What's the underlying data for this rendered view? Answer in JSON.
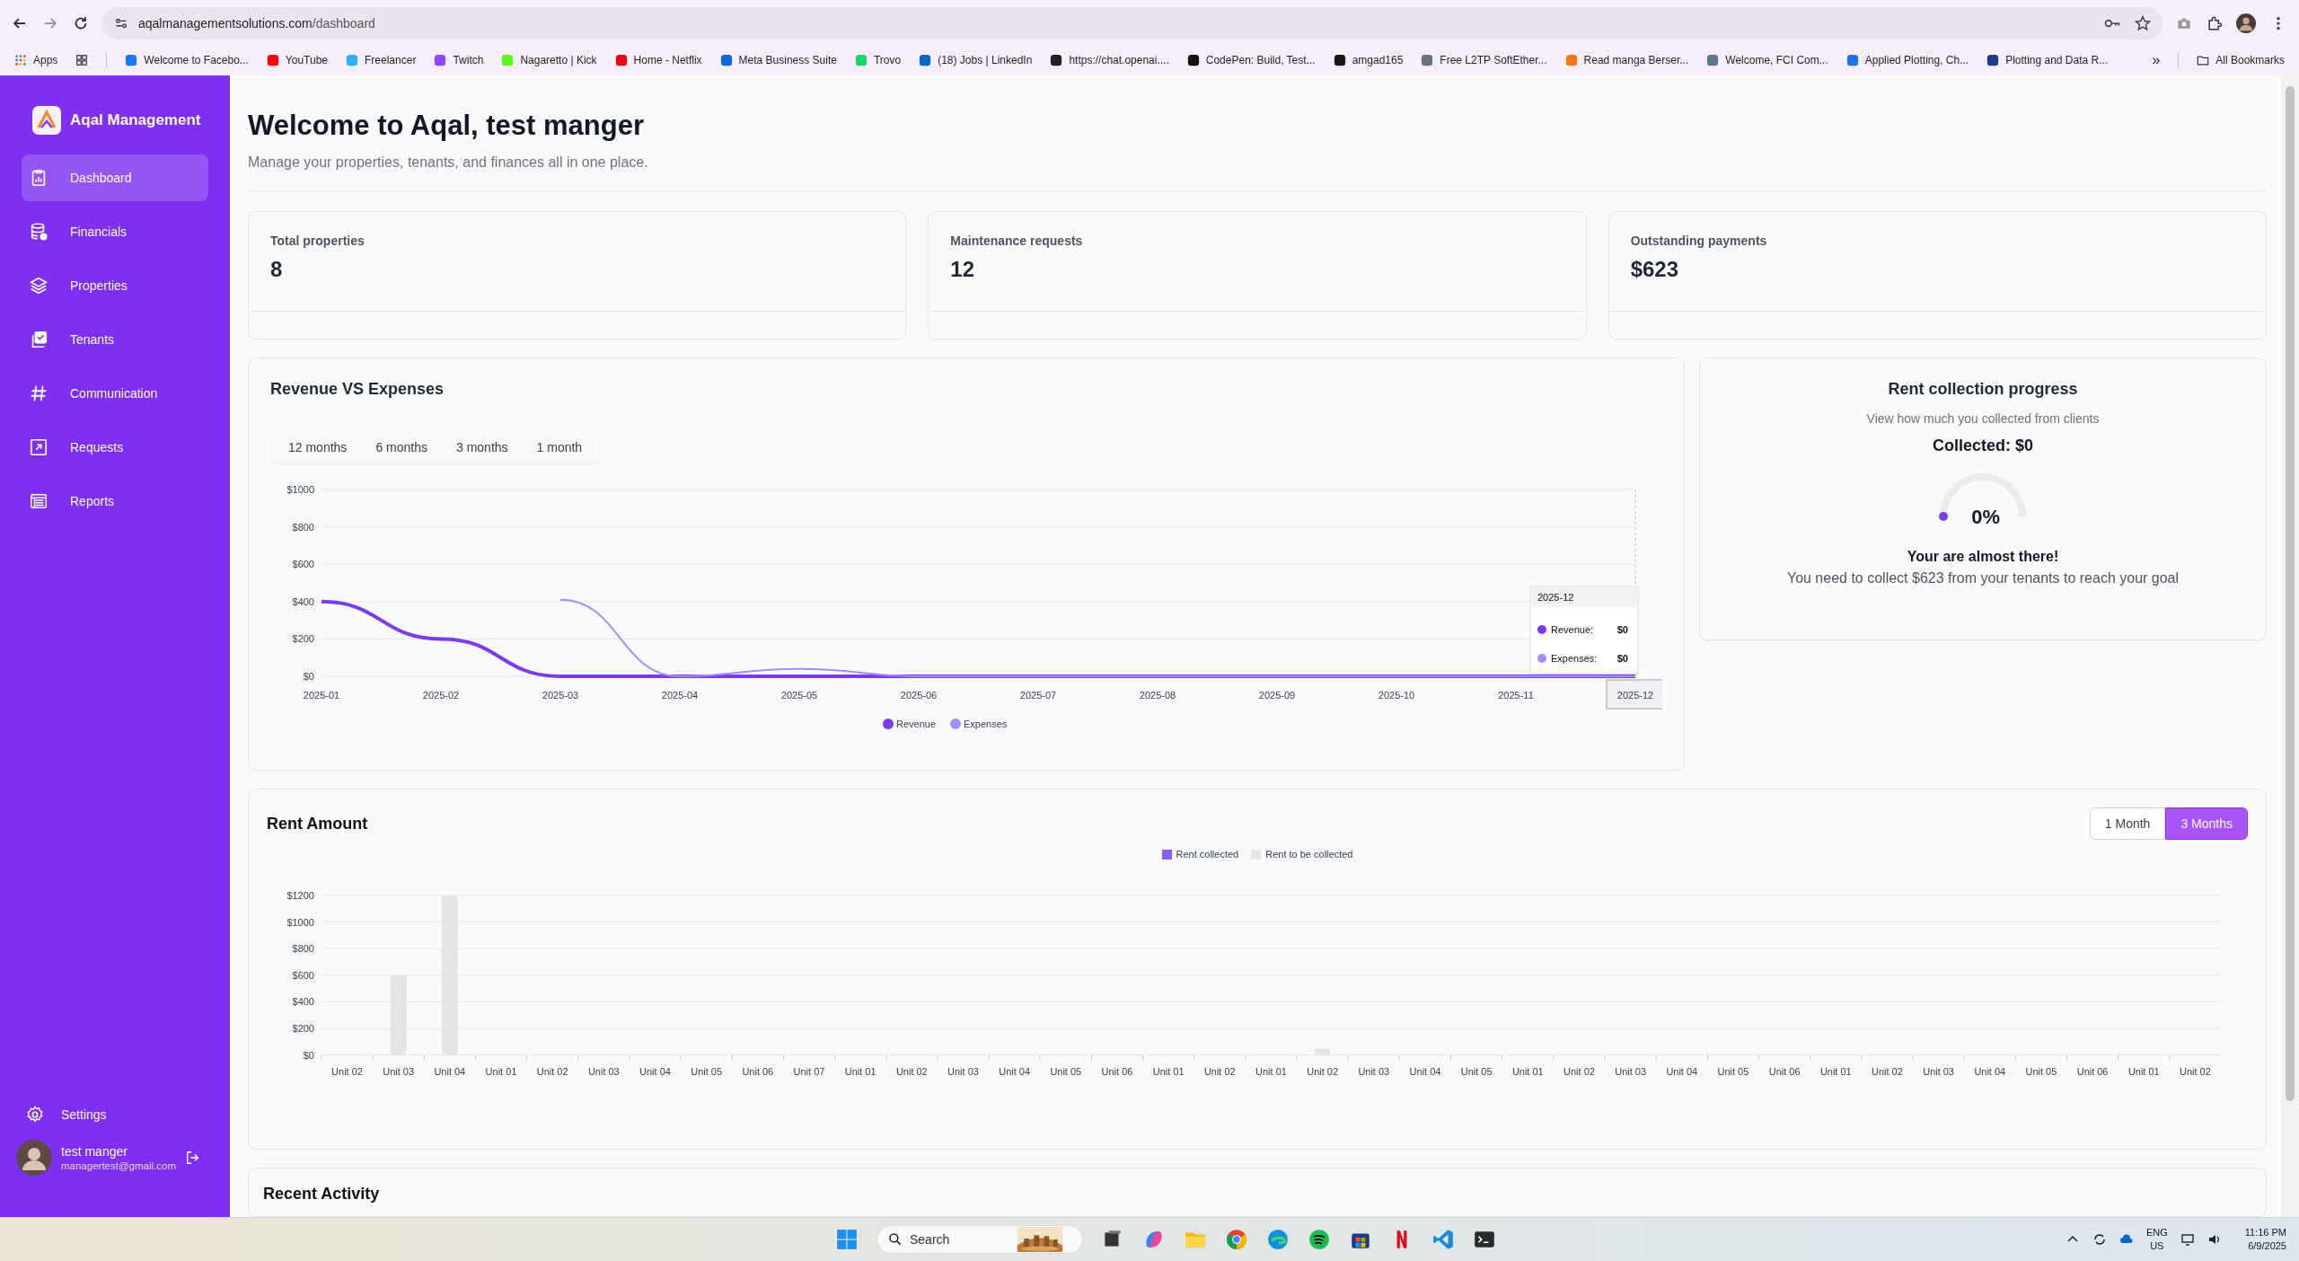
{
  "browser": {
    "url_host": "aqalmanagementsolutions.com",
    "url_path": "/dashboard",
    "apps_label": "Apps",
    "more": "»",
    "all_bookmarks": "All Bookmarks",
    "bookmarks": [
      {
        "label": "Welcome to Facebo...",
        "color": "#1877f2"
      },
      {
        "label": "YouTube",
        "color": "#ff0000"
      },
      {
        "label": "Freelancer",
        "color": "#29b2fe"
      },
      {
        "label": "Twitch",
        "color": "#9146ff"
      },
      {
        "label": "Nagaretto | Kick",
        "color": "#53fc18"
      },
      {
        "label": "Home - Netflix",
        "color": "#e50914"
      },
      {
        "label": "Meta Business Suite",
        "color": "#0668e1"
      },
      {
        "label": "Trovo",
        "color": "#19d66b"
      },
      {
        "label": "(18) Jobs | LinkedIn",
        "color": "#0a66c2"
      },
      {
        "label": "https://chat.openai....",
        "color": "#202123"
      },
      {
        "label": "CodePen: Build, Test...",
        "color": "#111111"
      },
      {
        "label": "amgad165",
        "color": "#181717"
      },
      {
        "label": "Free L2TP SoftEther...",
        "color": "#6b7280"
      },
      {
        "label": "Read manga Berser...",
        "color": "#f97316"
      },
      {
        "label": "Welcome, FCI Com...",
        "color": "#64748b"
      },
      {
        "label": "Applied Plotting, Ch...",
        "color": "#1a73e8"
      },
      {
        "label": "Plotting and Data R...",
        "color": "#1e3a8a"
      }
    ]
  },
  "sidebar": {
    "brand": "Aqal Management",
    "items": [
      {
        "label": "Dashboard",
        "kind": "clipboard",
        "selected": true
      },
      {
        "label": "Financials",
        "kind": "database",
        "selected": false
      },
      {
        "label": "Properties",
        "kind": "layers",
        "selected": false
      },
      {
        "label": "Tenants",
        "kind": "checklist",
        "selected": false
      },
      {
        "label": "Communication",
        "kind": "hash",
        "selected": false
      },
      {
        "label": "Requests",
        "kind": "arrow",
        "selected": false
      },
      {
        "label": "Reports",
        "kind": "table",
        "selected": false
      }
    ],
    "settings": "Settings",
    "user": {
      "name": "test manger",
      "email": "managertest@gmail.com"
    }
  },
  "page": {
    "title": "Welcome to Aqal, test manger",
    "subtitle": "Manage your properties, tenants, and finances all in one place."
  },
  "stats": [
    {
      "label": "Total properties",
      "value": "8"
    },
    {
      "label": "Maintenance requests",
      "value": "12"
    },
    {
      "label": "Outstanding payments",
      "value": "$623"
    }
  ],
  "revenue": {
    "title": "Revenue VS Expenses",
    "ranges": [
      {
        "label": "12 months",
        "selected": false
      },
      {
        "label": "6 months",
        "selected": false
      },
      {
        "label": "3 months",
        "selected": false
      },
      {
        "label": "1 month",
        "selected": false
      }
    ],
    "cursor_visible": true,
    "tooltip": {
      "title": "2025-12",
      "rows": [
        {
          "label": "Revenue:",
          "value": "$0"
        },
        {
          "label": "Expenses:",
          "value": "$0"
        }
      ]
    },
    "chart_data": {
      "type": "line",
      "categories": [
        "2025-01",
        "2025-02",
        "2025-03",
        "2025-04",
        "2025-05",
        "2025-06",
        "2025-07",
        "2025-08",
        "2025-09",
        "2025-10",
        "2025-11",
        "2025-12"
      ],
      "series": [
        {
          "name": "Revenue",
          "color": "#7c3aed",
          "values": [
            400,
            200,
            0,
            0,
            0,
            0,
            0,
            0,
            0,
            0,
            0,
            0
          ]
        },
        {
          "name": "Expenses",
          "color": "#a78bfa",
          "values": [
            null,
            null,
            410,
            0,
            40,
            0,
            0,
            0,
            0,
            0,
            0,
            0
          ]
        }
      ],
      "ylim": [
        0,
        1000
      ],
      "grid": true,
      "legend": true,
      "yticks": [
        {
          "value": 0,
          "label": "$0"
        },
        {
          "value": 200,
          "label": "$200"
        },
        {
          "value": 400,
          "label": "$400"
        },
        {
          "value": 600,
          "label": "$600"
        },
        {
          "value": 800,
          "label": "$800"
        },
        {
          "value": 1000,
          "label": "$1000"
        }
      ]
    }
  },
  "progress": {
    "title": "Rent collection progress",
    "subtitle": "View how much you collected from clients",
    "collected": "Collected: $0",
    "level": 0,
    "percent": "0%",
    "message": "Your are almost there!",
    "detail": "You need to collect $623 from your tenants to reach your goal"
  },
  "rent": {
    "title": "Rent Amount",
    "ranges": [
      {
        "label": "1 Month",
        "selected": false
      },
      {
        "label": "3 Months",
        "selected": true
      }
    ],
    "chart_data": {
      "type": "bar",
      "stacked": true,
      "categories": [
        "Unit 02",
        "Unit 03",
        "Unit 04",
        "Unit 01",
        "Unit 02",
        "Unit 03",
        "Unit 04",
        "Unit 05",
        "Unit 06",
        "Unit 07",
        "Unit 01",
        "Unit 02",
        "Unit 03",
        "Unit 04",
        "Unit 05",
        "Unit 06",
        "Unit 01",
        "Unit 02",
        "Unit 01",
        "Unit 02",
        "Unit 03",
        "Unit 04",
        "Unit 05",
        "Unit 01",
        "Unit 02",
        "Unit 03",
        "Unit 04",
        "Unit 05",
        "Unit 06",
        "Unit 01",
        "Unit 02",
        "Unit 03",
        "Unit 04",
        "Unit 05",
        "Unit 06",
        "Unit 01",
        "Unit 02"
      ],
      "series": [
        {
          "name": "Rent collected",
          "color": "#8b5cf6",
          "values": [
            0,
            0,
            0,
            0,
            0,
            0,
            0,
            0,
            0,
            0,
            0,
            0,
            0,
            0,
            0,
            0,
            0,
            0,
            0,
            0,
            0,
            0,
            0,
            0,
            0,
            0,
            0,
            0,
            0,
            0,
            0,
            0,
            0,
            0,
            0,
            0,
            0
          ]
        },
        {
          "name": "Rent to be collected",
          "color": "#e5e5e5",
          "values": [
            0,
            600,
            1200,
            0,
            0,
            0,
            0,
            0,
            0,
            0,
            0,
            0,
            0,
            0,
            0,
            0,
            0,
            0,
            0,
            50,
            0,
            0,
            0,
            0,
            0,
            0,
            0,
            0,
            0,
            0,
            0,
            0,
            0,
            0,
            0,
            0,
            0
          ]
        }
      ],
      "ylim": [
        0,
        1200
      ],
      "grid": true,
      "yticks": [
        {
          "value": 0,
          "label": "$0"
        },
        {
          "value": 200,
          "label": "$200"
        },
        {
          "value": 400,
          "label": "$400"
        },
        {
          "value": 600,
          "label": "$600"
        },
        {
          "value": 800,
          "label": "$800"
        },
        {
          "value": 1000,
          "label": "$1000"
        },
        {
          "value": 1200,
          "label": "$1200"
        }
      ]
    }
  },
  "recent": {
    "title": "Recent Activity"
  },
  "taskbar": {
    "search_placeholder": "Search",
    "lang": "ENG",
    "region": "US",
    "time": "11:16 PM",
    "date": "6/9/2025"
  }
}
